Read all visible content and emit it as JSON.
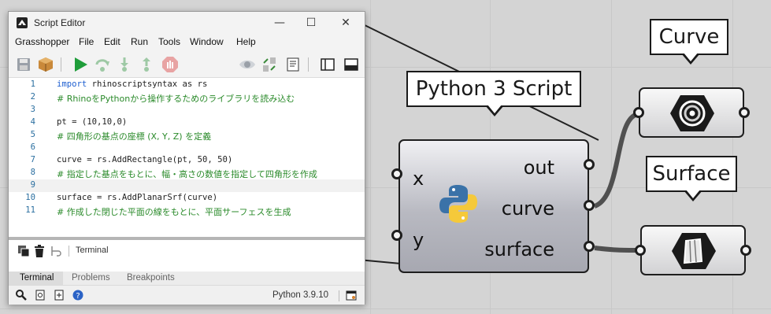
{
  "window": {
    "title": "Script Editor",
    "minimize_glyph": "—",
    "maximize_glyph": "☐",
    "close_glyph": "✕"
  },
  "menu": [
    "Grasshopper",
    "File",
    "Edit",
    "Run",
    "Tools",
    "Window",
    "Help"
  ],
  "toolbar": {
    "icons": [
      "save-icon",
      "package-icon",
      "run-icon",
      "redo-icon",
      "step-in-icon",
      "step-out-icon",
      "stop-icon",
      "eye-icon",
      "swap-icon",
      "document-icon",
      "sidebar-icon",
      "panel-icon"
    ]
  },
  "editor": {
    "lines": [
      {
        "num": "1",
        "text": "rhinoscriptsyntax as rs",
        "kw": "import",
        "comment": false
      },
      {
        "num": "2",
        "text": "# RhinoをPythonから操作するためのライブラリを読み込む",
        "kw": "",
        "comment": true
      },
      {
        "num": "3",
        "text": "",
        "kw": "",
        "comment": false
      },
      {
        "num": "4",
        "text": "pt = (10,10,0)",
        "kw": "",
        "comment": false
      },
      {
        "num": "5",
        "text": "# 四角形の基点の座標 (X, Y, Z) を定義",
        "kw": "",
        "comment": true
      },
      {
        "num": "6",
        "text": "",
        "kw": "",
        "comment": false
      },
      {
        "num": "7",
        "text": "curve = rs.AddRectangle(pt, 50, 50)",
        "kw": "",
        "comment": false
      },
      {
        "num": "8",
        "text": "# 指定した基点をもとに、幅・高さの数値を指定して四角形を作成",
        "kw": "",
        "comment": true
      },
      {
        "num": "9",
        "text": "",
        "kw": "",
        "comment": false
      },
      {
        "num": "10",
        "text": "surface = rs.AddPlanarSrf(curve)",
        "kw": "",
        "comment": false
      },
      {
        "num": "11",
        "text": "# 作成した閉じた平面の線をもとに、平面サーフェスを生成",
        "kw": "",
        "comment": true
      }
    ],
    "keyword_color": "#1e5fd0",
    "comment_color": "#2a8a2a",
    "line_number_color": "#2b6fa0"
  },
  "terminal": {
    "label": "Terminal",
    "icons": [
      "copy-icon",
      "trash-icon",
      "wrap-icon"
    ]
  },
  "tabs": [
    "Terminal",
    "Problems",
    "Breakpoints"
  ],
  "status": {
    "version": "Python 3.9.10",
    "icons": [
      "search-icon",
      "doc-search-icon",
      "doc-add-icon",
      "help-icon",
      "settings-icon"
    ]
  },
  "component": {
    "callout": "Python 3 Script",
    "inputs": [
      "x",
      "y"
    ],
    "outputs": [
      "out",
      "curve",
      "surface"
    ]
  },
  "curve_component": {
    "callout": "Curve"
  },
  "surface_component": {
    "callout": "Surface"
  }
}
